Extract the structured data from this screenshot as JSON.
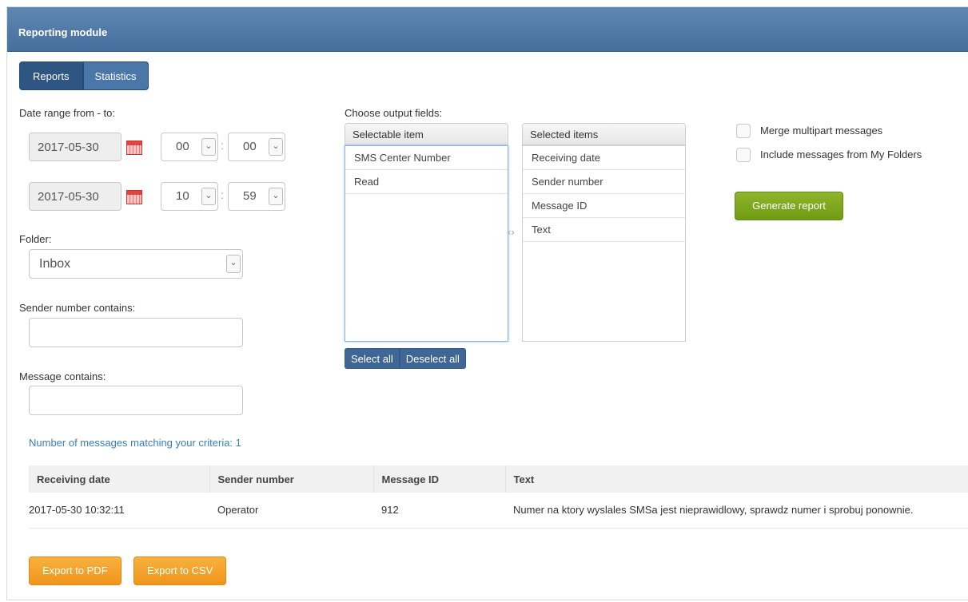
{
  "module": {
    "title": "Reporting module"
  },
  "tabs": [
    {
      "label": "Reports"
    },
    {
      "label": "Statistics"
    }
  ],
  "date_range": {
    "label": "Date range from - to:",
    "from": {
      "date": "2017-05-30",
      "hour": "00",
      "minute": "00"
    },
    "to": {
      "date": "2017-05-30",
      "hour": "10",
      "minute": "59"
    }
  },
  "folder": {
    "label": "Folder:",
    "value": "Inbox"
  },
  "sender": {
    "label": "Sender number contains:",
    "value": ""
  },
  "message": {
    "label": "Message contains:",
    "value": ""
  },
  "output_fields": {
    "label": "Choose output fields:",
    "selectable_header": "Selectable item",
    "selectable": [
      "SMS Center Number",
      "Read"
    ],
    "selected_header": "Selected items",
    "selected": [
      "Receiving date",
      "Sender number",
      "Message ID",
      "Text"
    ],
    "select_all": "Select all",
    "deselect_all": "Deselect all"
  },
  "options": {
    "merge": "Merge multipart messages",
    "include_folders": "Include messages from My Folders"
  },
  "generate": "Generate report",
  "result_count": "Number of messages matching your criteria: 1",
  "results": {
    "columns": [
      "Receiving date",
      "Sender number",
      "Message ID",
      "Text"
    ],
    "rows": [
      [
        "2017-05-30 10:32:11",
        "Operator",
        "912",
        "Numer na ktory wyslales SMSa jest nieprawidlowy, sprawdz numer i sprobuj ponownie."
      ]
    ]
  },
  "export": {
    "pdf": "Export to PDF",
    "csv": "Export to CSV"
  }
}
